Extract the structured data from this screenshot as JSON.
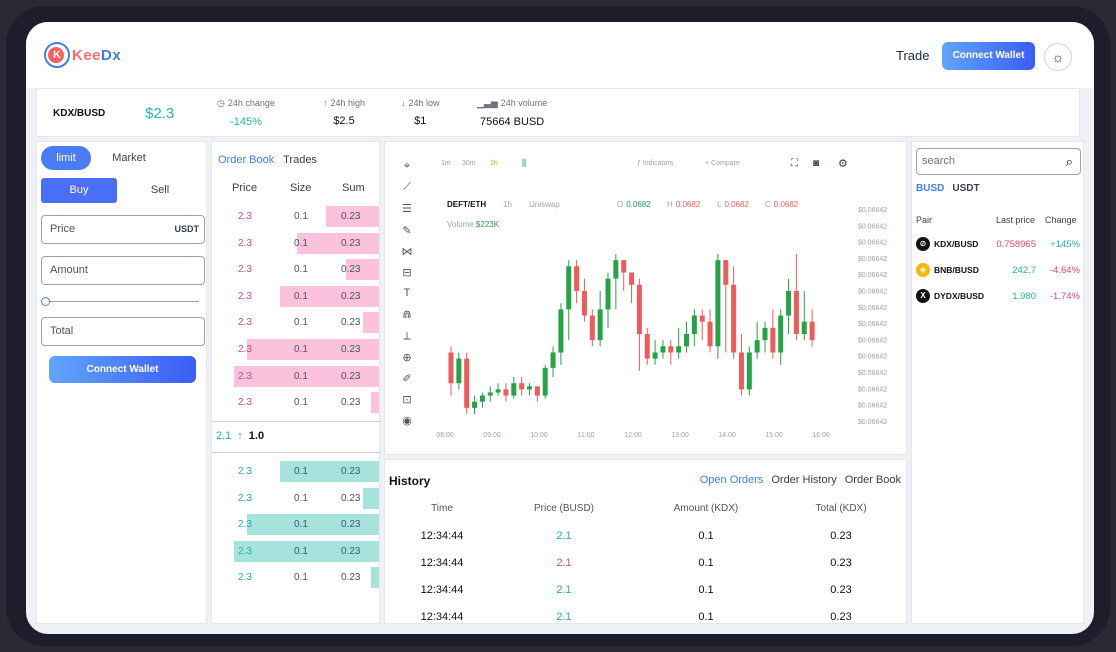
{
  "brand": {
    "logo_text_a": "Kee",
    "logo_text_b": "Dx"
  },
  "nav": {
    "trade": "Trade",
    "connect_wallet": "Connect Wallet",
    "theme_icon": "sun-icon"
  },
  "ticker": {
    "pair": "KDX/BUSD",
    "price": "$2.3",
    "stats": [
      {
        "label": "24h change",
        "value": "-145%",
        "color": "#22b8a6",
        "icon": "clock-icon",
        "glyph": "◷"
      },
      {
        "label": "24h high",
        "value": "$2.5",
        "color": "#111111",
        "icon": "arrow-up-icon",
        "glyph": "↑"
      },
      {
        "label": "24h low",
        "value": "$1",
        "color": "#111111",
        "icon": "arrow-down-icon",
        "glyph": "↓"
      },
      {
        "label": "24h volume",
        "value": "75664 BUSD",
        "color": "#111111",
        "icon": "bar-chart-icon",
        "glyph": "▁▃▅"
      }
    ]
  },
  "order_form": {
    "tabs": [
      "limit",
      "Market"
    ],
    "sides": [
      "Buy",
      "Sell"
    ],
    "price_placeholder": "Price",
    "price_unit": "USDT",
    "amount_placeholder": "Amount",
    "total_placeholder": "Total",
    "connect_wallet": "Connect Wallet",
    "slider_value": 0
  },
  "orderbook": {
    "tabs": [
      "Order Book",
      "Trades"
    ],
    "headers": [
      "Price",
      "Size",
      "Sum"
    ],
    "asks": [
      {
        "price": "2.3",
        "size": "0.1",
        "sum": "0.23",
        "depth": 0.32
      },
      {
        "price": "2.3",
        "size": "0.1",
        "sum": "0.23",
        "depth": 0.5
      },
      {
        "price": "2.3",
        "size": "0.1",
        "sum": "0.23",
        "depth": 0.2
      },
      {
        "price": "2.3",
        "size": "0.1",
        "sum": "0.23",
        "depth": 0.6
      },
      {
        "price": "2.3",
        "size": "0.1",
        "sum": "0.23",
        "depth": 0.1
      },
      {
        "price": "2.3",
        "size": "0.1",
        "sum": "0.23",
        "depth": 0.8
      },
      {
        "price": "2.3",
        "size": "0.1",
        "sum": "0.23",
        "depth": 0.88
      },
      {
        "price": "2.3",
        "size": "0.1",
        "sum": "0.23",
        "depth": 0.05
      }
    ],
    "mid": {
      "price": "2.1",
      "arrow": "↑",
      "value": "1.0"
    },
    "bids": [
      {
        "price": "2.3",
        "size": "0.1",
        "sum": "0.23",
        "depth": 0.6
      },
      {
        "price": "2.3",
        "size": "0.1",
        "sum": "0.23",
        "depth": 0.1
      },
      {
        "price": "2.3",
        "size": "0.1",
        "sum": "0.23",
        "depth": 0.8
      },
      {
        "price": "2.3",
        "size": "0.1",
        "sum": "0.23",
        "depth": 0.88
      },
      {
        "price": "2.3",
        "size": "0.1",
        "sum": "0.23",
        "depth": 0.05
      }
    ]
  },
  "chart": {
    "top": {
      "intervals": [
        "1m",
        "30m",
        "1h"
      ],
      "indicators": "Indicators",
      "compare": "Compare"
    },
    "pair": "DEFT/ETH",
    "interval": "1h",
    "source": "Uniswap",
    "ohlc": [
      {
        "k": "O",
        "v": "0.0682"
      },
      {
        "k": "H",
        "v": "0.0682"
      },
      {
        "k": "L",
        "v": "0.0682"
      },
      {
        "k": "C",
        "v": "0.0682"
      }
    ],
    "volume_label": "Volume",
    "volume_value": "$223K",
    "colors": {
      "up": "#22a447",
      "down": "#ef5b5b"
    },
    "tools": [
      "crosshair-icon",
      "trendline-icon",
      "fib-icon",
      "brush-icon",
      "pattern-icon",
      "forecast-icon",
      "text-icon",
      "magnet-icon",
      "ruler-icon",
      "zoom-icon",
      "measure-icon",
      "lock-icon",
      "eye-icon"
    ]
  },
  "chart_data": {
    "type": "candlestick",
    "title": "",
    "xlabel": "",
    "ylabel": "",
    "x_ticks": [
      "08:00",
      "09:00",
      "10:00",
      "11:00",
      "12:00",
      "13:00",
      "14:00",
      "15:00",
      "16:00"
    ],
    "y_ticks": [
      "$0.06642",
      "$0.06642",
      "$0.06642",
      "$0.06642",
      "$0.06642",
      "$0.06642",
      "$0.06642",
      "$0.06642",
      "$0.06642",
      "$0.06642",
      "$0.06642",
      "$0.06642",
      "$0.06642",
      "$0.06642"
    ],
    "candles": [
      [
        0,
        10,
        5,
        11,
        3
      ],
      [
        1,
        5,
        9,
        10,
        4
      ],
      [
        2,
        9,
        1,
        10,
        0
      ],
      [
        3,
        1,
        2,
        3,
        0
      ],
      [
        4,
        2,
        3,
        3.5,
        1
      ],
      [
        5,
        3,
        3.5,
        4.5,
        2
      ],
      [
        6,
        3.5,
        4,
        5,
        3
      ],
      [
        7,
        4,
        3,
        5,
        2
      ],
      [
        8,
        3,
        5,
        6,
        2.5
      ],
      [
        9,
        5,
        4,
        6,
        3
      ],
      [
        10,
        4,
        4.5,
        5,
        3
      ],
      [
        11,
        4.5,
        3,
        4,
        2
      ],
      [
        12,
        3,
        7.5,
        8,
        2.5
      ],
      [
        13,
        7.5,
        10,
        11,
        6
      ],
      [
        14,
        10,
        17,
        18,
        8
      ],
      [
        15,
        17,
        24,
        25,
        12
      ],
      [
        16,
        24,
        20,
        25,
        18
      ],
      [
        17,
        20,
        16,
        22,
        15
      ],
      [
        18,
        16,
        12,
        17,
        11
      ],
      [
        19,
        12,
        17,
        20,
        11
      ],
      [
        20,
        17,
        22,
        23,
        14
      ],
      [
        21,
        22,
        25,
        26,
        17
      ],
      [
        22,
        25,
        23,
        25,
        20
      ],
      [
        23,
        23,
        21,
        23,
        18
      ],
      [
        24,
        21,
        13,
        22,
        7
      ],
      [
        25,
        13,
        9,
        14,
        8
      ],
      [
        26,
        9,
        10,
        12,
        8
      ],
      [
        27,
        10,
        11,
        12,
        9
      ],
      [
        28,
        11,
        10,
        12,
        8
      ],
      [
        29,
        10,
        11,
        14,
        9
      ],
      [
        30,
        11,
        13,
        15,
        10
      ],
      [
        31,
        13,
        16,
        17,
        11
      ],
      [
        32,
        16,
        15,
        17,
        12
      ],
      [
        33,
        15,
        11,
        17,
        10
      ],
      [
        34,
        11,
        25,
        26,
        9
      ],
      [
        35,
        25,
        21,
        25,
        10
      ],
      [
        36,
        21,
        10,
        24,
        9
      ],
      [
        37,
        10,
        4,
        13,
        3
      ],
      [
        38,
        4,
        10,
        11,
        3
      ],
      [
        39,
        10,
        12,
        15,
        9
      ],
      [
        40,
        12,
        14,
        15,
        10
      ],
      [
        41,
        14,
        10,
        17,
        9
      ],
      [
        42,
        10,
        16,
        17,
        8
      ],
      [
        43,
        16,
        20,
        22,
        13
      ],
      [
        44,
        20,
        13,
        26,
        12
      ],
      [
        45,
        13,
        15,
        20,
        12
      ],
      [
        46,
        15,
        12,
        17,
        11
      ]
    ]
  },
  "history": {
    "title": "History",
    "tabs": [
      "Open Orders",
      "Order History",
      "Order Book"
    ],
    "headers": [
      "Time",
      "Price (BUSD)",
      "Amount (KDX)",
      "Total (KDX)"
    ],
    "rows": [
      {
        "time": "12:34:44",
        "price": "2.1",
        "amount": "0.1",
        "total": "0.23",
        "side": "buy"
      },
      {
        "time": "12:34:44",
        "price": "2.1",
        "amount": "0.1",
        "total": "0.23",
        "side": "sell"
      },
      {
        "time": "12:34:44",
        "price": "2.1",
        "amount": "0.1",
        "total": "0.23",
        "side": "buy"
      },
      {
        "time": "12:34:44",
        "price": "2.1",
        "amount": "0.1",
        "total": "0.23",
        "side": "buy"
      }
    ]
  },
  "markets": {
    "search_placeholder": "search",
    "quotes": [
      "BUSD",
      "USDT"
    ],
    "headers": [
      "Pair",
      "Last price",
      "Change"
    ],
    "rows": [
      {
        "pair": "KDX/BUSD",
        "last": "0.758965",
        "change": "+145%",
        "icon_bg": "#111111",
        "icon_glyph": "⊘",
        "last_color": "#e0457b",
        "change_color": "#1fb5a3"
      },
      {
        "pair": "BNB/BUSD",
        "last": "242.7",
        "change": "-4.64%",
        "icon_bg": "#f0b90b",
        "icon_glyph": "◈",
        "last_color": "#1fb5a3",
        "change_color": "#e0457b"
      },
      {
        "pair": "DYDX/BUSD",
        "last": "1.980",
        "change": "-1.74%",
        "icon_bg": "#111111",
        "icon_glyph": "X",
        "last_color": "#1fb5a3",
        "change_color": "#e0457b"
      }
    ]
  }
}
